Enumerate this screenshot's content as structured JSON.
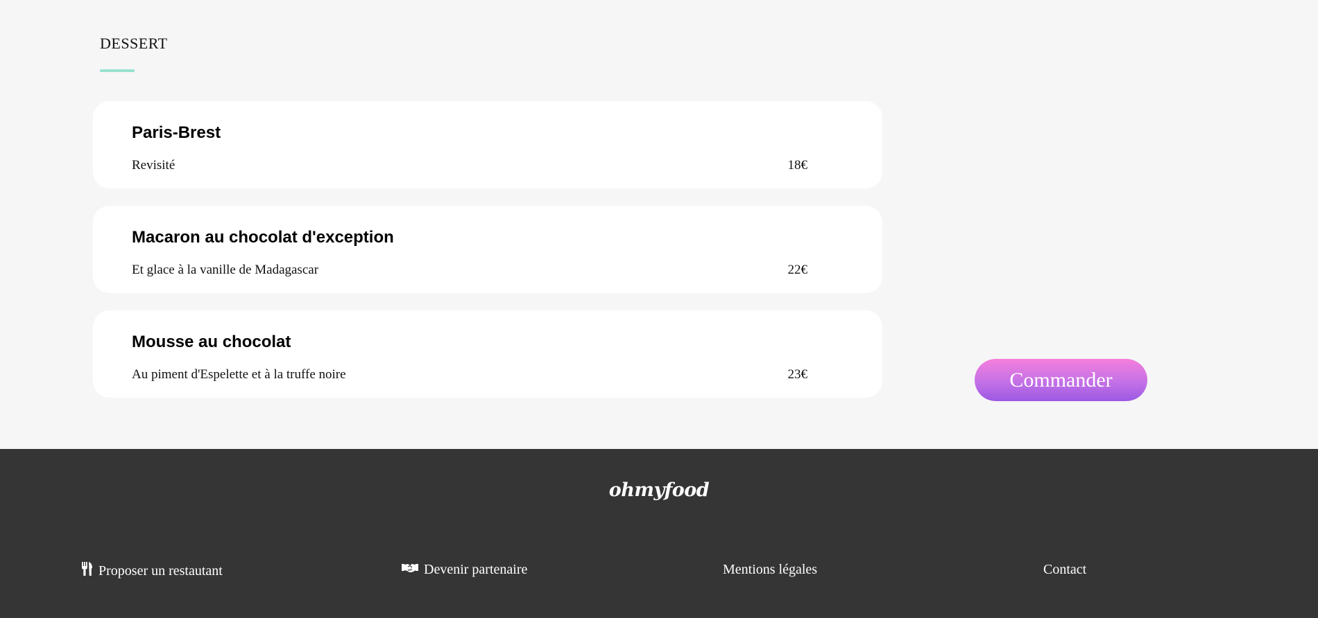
{
  "section": {
    "title": "DESSERT",
    "accent_color": "#99e2d0"
  },
  "dishes": [
    {
      "name": "Paris-Brest",
      "description": "Revisité",
      "price": "18€"
    },
    {
      "name": "Macaron au chocolat d'exception",
      "description": "Et glace à la vanille de Madagascar",
      "price": "22€"
    },
    {
      "name": "Mousse au chocolat",
      "description": "Au piment d'Espelette et à la truffe noire",
      "price": "23€"
    }
  ],
  "order_button": {
    "label": "Commander",
    "gradient_top": "#f57fdc",
    "gradient_bottom": "#9b59e3"
  },
  "footer": {
    "logo": "ohmyfood",
    "background": "#353535",
    "links": [
      {
        "label": "Proposer un restautant",
        "icon": "utensils-icon"
      },
      {
        "label": "Devenir partenaire",
        "icon": "handshake-icon"
      },
      {
        "label": "Mentions légales"
      },
      {
        "label": "Contact"
      }
    ]
  }
}
